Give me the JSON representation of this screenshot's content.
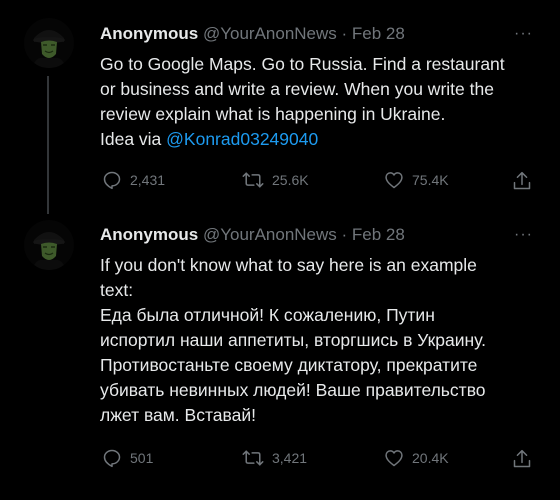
{
  "tweets": [
    {
      "display_name": "Anonymous",
      "handle": "@YourAnonNews",
      "date": "Feb 28",
      "separator": " · ",
      "more": "···",
      "lines": [
        "Go to Google Maps.  Go to Russia. Find a restaurant",
        "or business and write a review.   When you write the",
        "review explain what is happening in Ukraine."
      ],
      "idea_prefix": "Idea via ",
      "idea_mention": "@Konrad03249040",
      "replies": "2,431",
      "retweets": "25.6K",
      "likes": "75.4K"
    },
    {
      "display_name": "Anonymous",
      "handle": "@YourAnonNews",
      "date": "Feb 28",
      "separator": " · ",
      "more": "···",
      "lines": [
        "If you don't know what to say here is an example",
        "text:",
        "Еда была отличной! К сожалению, Путин",
        "испортил наши аппетиты, вторгшись в Украину.",
        "Противостаньте своему диктатору, прекратите",
        "убивать невинных людей! Ваше правительство",
        "лжет вам. Вставай!"
      ],
      "replies": "501",
      "retweets": "3,421",
      "likes": "20.4K"
    }
  ],
  "colors": {
    "background": "#000000",
    "text": "#e7e9ea",
    "muted": "#71767b",
    "link": "#1d9bf0",
    "thread_line": "#333639"
  },
  "icons": [
    "avatar-mask",
    "more-icon",
    "reply-icon",
    "retweet-icon",
    "like-icon",
    "share-icon"
  ]
}
